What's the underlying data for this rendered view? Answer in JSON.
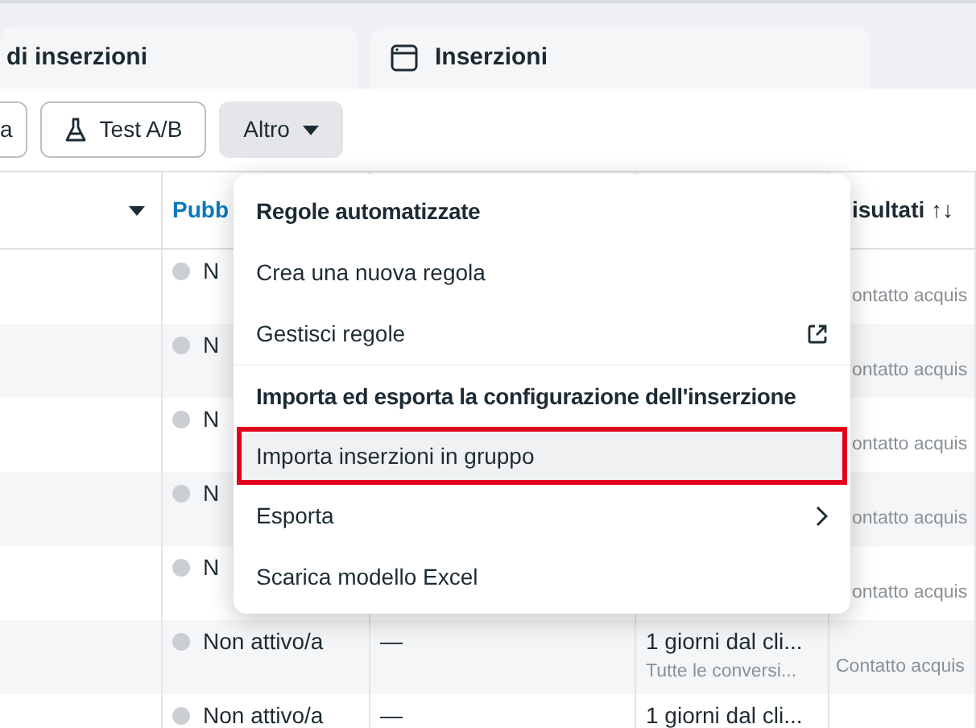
{
  "tabs": [
    {
      "label": "di inserzioni",
      "kind": "plain"
    },
    {
      "label": "Inserzioni",
      "kind": "window"
    }
  ],
  "toolbar": [
    {
      "label": "a",
      "kind": "outline"
    },
    {
      "label": "Test A/B",
      "kind": "flask"
    },
    {
      "label": "Altro",
      "kind": "dropdown"
    }
  ],
  "table": {
    "header": {
      "status": "Pubb",
      "results": "isultati",
      "results_sort": "↑↓"
    },
    "rows": [
      {
        "status": "N",
        "results": "ontatto acquis",
        "under_menu": true
      },
      {
        "status": "N",
        "results": "ontatto acquis",
        "under_menu": true
      },
      {
        "status": "N",
        "results": "ontatto acquis",
        "under_menu": true
      },
      {
        "status": "N",
        "results": "ontatto acquis",
        "under_menu": true
      },
      {
        "status": "N",
        "results": "ontatto acquis",
        "under_menu": true
      },
      {
        "status": "Non attivo/a",
        "spend": "—",
        "attribution": "1 giorni dal cli...",
        "attribution_sub": "Tutte le conversi...",
        "results": "Contatto acquis",
        "under_menu": false
      },
      {
        "status": "Non attivo/a",
        "spend": "—",
        "attribution": "1 giorni dal cli..."
      }
    ]
  },
  "menu": {
    "items": [
      {
        "kind": "header",
        "label": "Regole automatizzate"
      },
      {
        "kind": "item",
        "label": "Crea una nuova regola",
        "selected": false
      },
      {
        "kind": "external",
        "label": "Gestisci regole",
        "selected": false
      },
      {
        "kind": "divider"
      },
      {
        "kind": "header",
        "label": "Importa ed esporta la configurazione dell'inserzione"
      },
      {
        "kind": "item",
        "label": "Importa inserzioni in gruppo",
        "selected": true
      },
      {
        "kind": "submenu",
        "label": "Esporta",
        "selected": false
      },
      {
        "kind": "item",
        "label": "Scarica modello Excel",
        "selected": false
      }
    ]
  }
}
